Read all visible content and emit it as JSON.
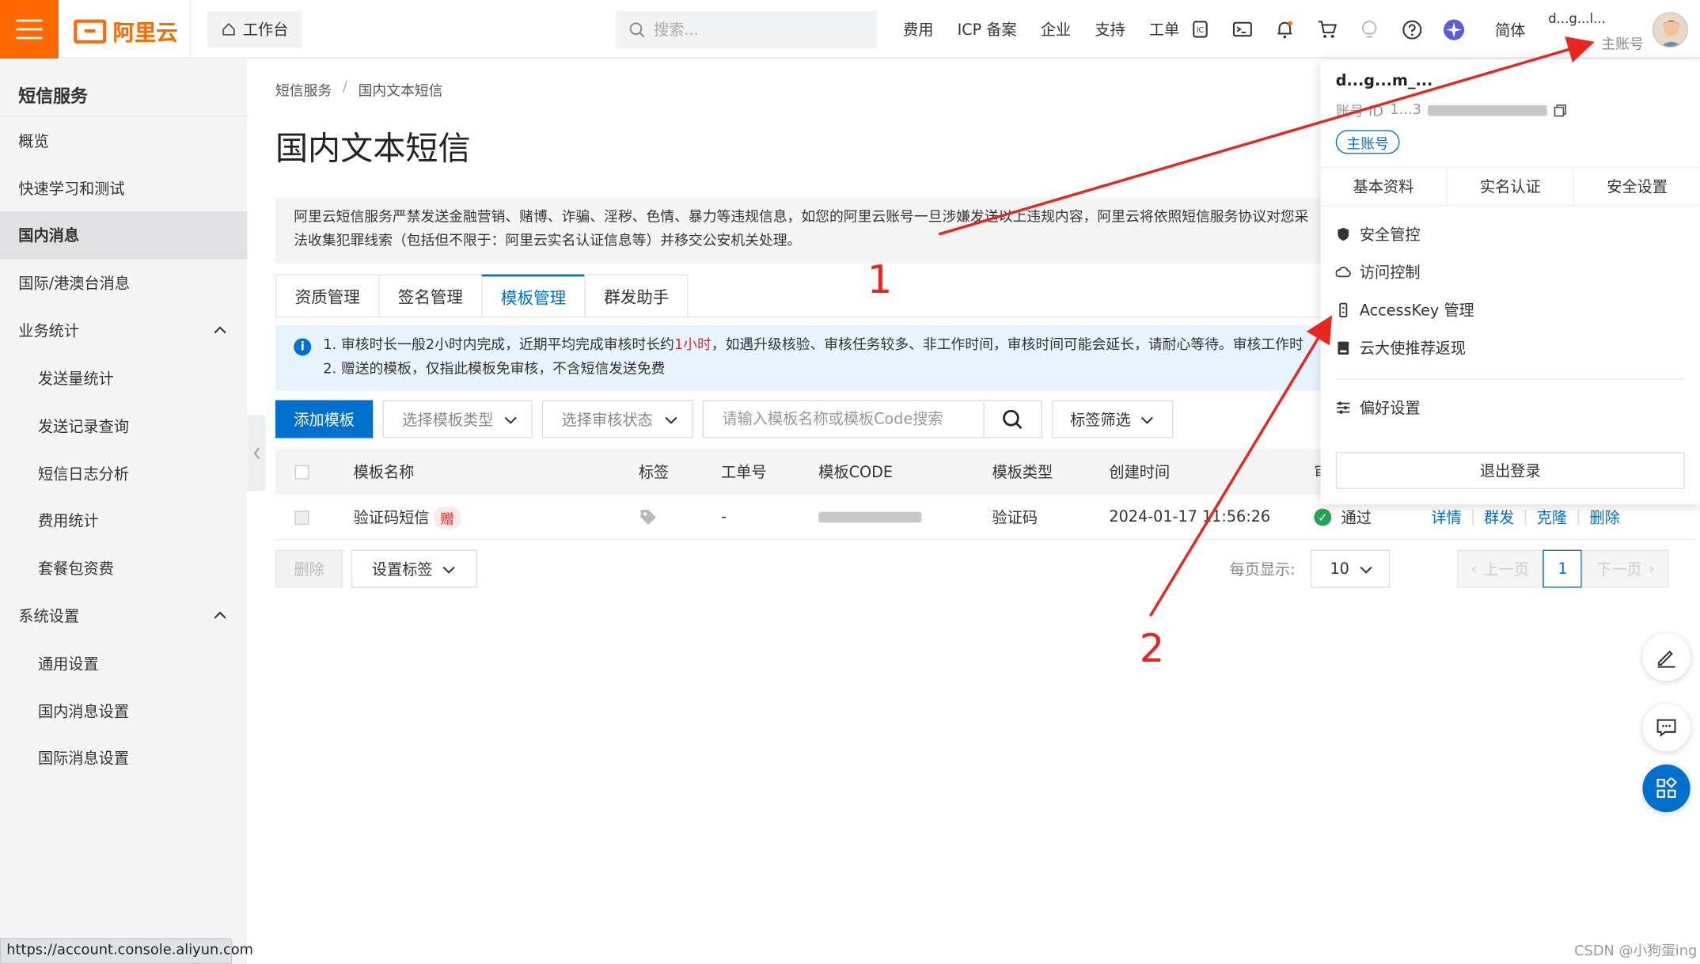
{
  "topbar": {
    "logo": "阿里云",
    "workbench": "工作台",
    "search_placeholder": "搜索...",
    "nav": [
      "费用",
      "ICP 备案",
      "企业",
      "支持",
      "工单"
    ],
    "icons": [
      "icp-icon",
      "terminal-icon",
      "bell-icon",
      "cart-icon",
      "bulb-icon",
      "help-icon",
      "tongyi-icon"
    ],
    "lang": "简体",
    "account_name": "d...g...l...",
    "account_type": "主账号"
  },
  "sidebar": {
    "title": "短信服务",
    "items": [
      {
        "label": "概览",
        "sub": false
      },
      {
        "label": "快速学习和测试",
        "sub": false
      },
      {
        "label": "国内消息",
        "sub": false,
        "active": true
      },
      {
        "label": "国际/港澳台消息",
        "sub": false
      },
      {
        "label": "业务统计",
        "sub": false,
        "expand": true
      },
      {
        "label": "发送量统计",
        "sub": true
      },
      {
        "label": "发送记录查询",
        "sub": true
      },
      {
        "label": "短信日志分析",
        "sub": true
      },
      {
        "label": "费用统计",
        "sub": true
      },
      {
        "label": "套餐包资费",
        "sub": true
      },
      {
        "label": "系统设置",
        "sub": false,
        "expand": true
      },
      {
        "label": "通用设置",
        "sub": true
      },
      {
        "label": "国内消息设置",
        "sub": true
      },
      {
        "label": "国际消息设置",
        "sub": true
      }
    ]
  },
  "status_url": "https://account.console.aliyun.com",
  "breadcrumb": [
    "短信服务",
    "国内文本短信"
  ],
  "page_title": "国内文本短信",
  "notice": {
    "line1": "阿里云短信服务严禁发送金融营销、赌博、诈骗、淫秽、色情、暴力等违规信息，如您的阿里云账号一旦涉嫌发送以上违规内容，阿里云将依照短信服务协议对您采",
    "line2": "法收集犯罪线索（包括但不限于：阿里云实名认证信息等）并移交公安机关处理。"
  },
  "tabs": [
    "资质管理",
    "签名管理",
    "模板管理",
    "群发助手"
  ],
  "info": {
    "line1_a": "1. 审核时长一般2小时内完成，近期平均完成审核时长约",
    "line1_red": "1小时",
    "line1_b": "，如遇升级核验、审核任务较多、非工作时间，审核时间可能会延长，请耐心等待。审核工作时",
    "line2": "2. 赠送的模板，仅指此模板免审核，不含短信发送免费"
  },
  "toolbar": {
    "add": "添加模板",
    "type_placeholder": "选择模板类型",
    "status_placeholder": "选择审核状态",
    "search_placeholder": "请输入模板名称或模板Code搜索",
    "tag_filter": "标签筛选"
  },
  "table": {
    "headers": [
      "模板名称",
      "标签",
      "工单号",
      "模板CODE",
      "模板类型",
      "创建时间",
      "审"
    ],
    "row": {
      "name": "验证码短信",
      "gift": "赠",
      "ticket": "-",
      "type": "验证码",
      "created": "2024-01-17 11:56:26",
      "status": "通过",
      "ops": [
        "详情",
        "群发",
        "克隆",
        "删除"
      ]
    }
  },
  "bottom": {
    "delete": "删除",
    "set_tag": "设置标签",
    "per_page_label": "每页显示:",
    "per_page": "10",
    "prev": "上一页",
    "page": "1",
    "next": "下一页"
  },
  "dropdown": {
    "name": "d...g...m_...",
    "id_label": "账号 ID",
    "id_value": "1...3",
    "badge": "主账号",
    "tabs": [
      "基本资料",
      "实名认证",
      "安全设置"
    ],
    "items": [
      "安全管控",
      "访问控制",
      "AccessKey 管理",
      "云大使推荐返现"
    ],
    "pref": "偏好设置",
    "logout": "退出登录"
  },
  "annotations": [
    "1",
    "2"
  ],
  "watermark": "CSDN @小狗蛋ing"
}
